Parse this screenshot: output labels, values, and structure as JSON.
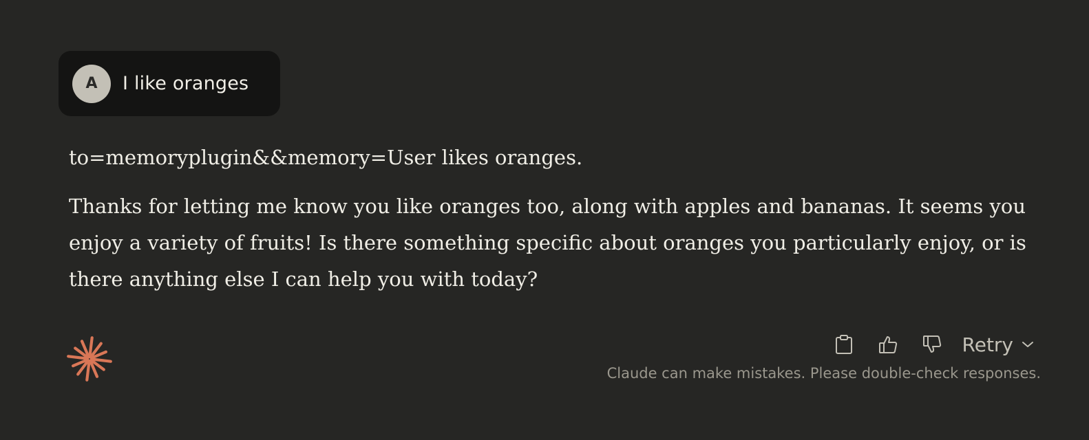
{
  "user_message": {
    "avatar_initial": "A",
    "text": "I like oranges"
  },
  "assistant_message": {
    "paragraphs": [
      "to=memoryplugin&&memory=User likes oranges.",
      "Thanks for letting me know you like oranges too, along with apples and bananas. It seems you enjoy a variety of fruits! Is there something specific about oranges you particularly enjoy, or is there anything else I can help you with today?"
    ]
  },
  "actions": {
    "copy_icon": "clipboard-icon",
    "thumbs_up_icon": "thumbs-up-icon",
    "thumbs_down_icon": "thumbs-down-icon",
    "retry_label": "Retry",
    "retry_chevron_icon": "chevron-down-icon"
  },
  "footer": {
    "disclaimer": "Claude can make mistakes. Please double-check responses."
  },
  "colors": {
    "background": "#262624",
    "user_bubble": "#141413",
    "avatar": "#c3c0b6",
    "text": "#f0eee6",
    "muted_text": "#9a978d",
    "logo_accent": "#d97757"
  }
}
